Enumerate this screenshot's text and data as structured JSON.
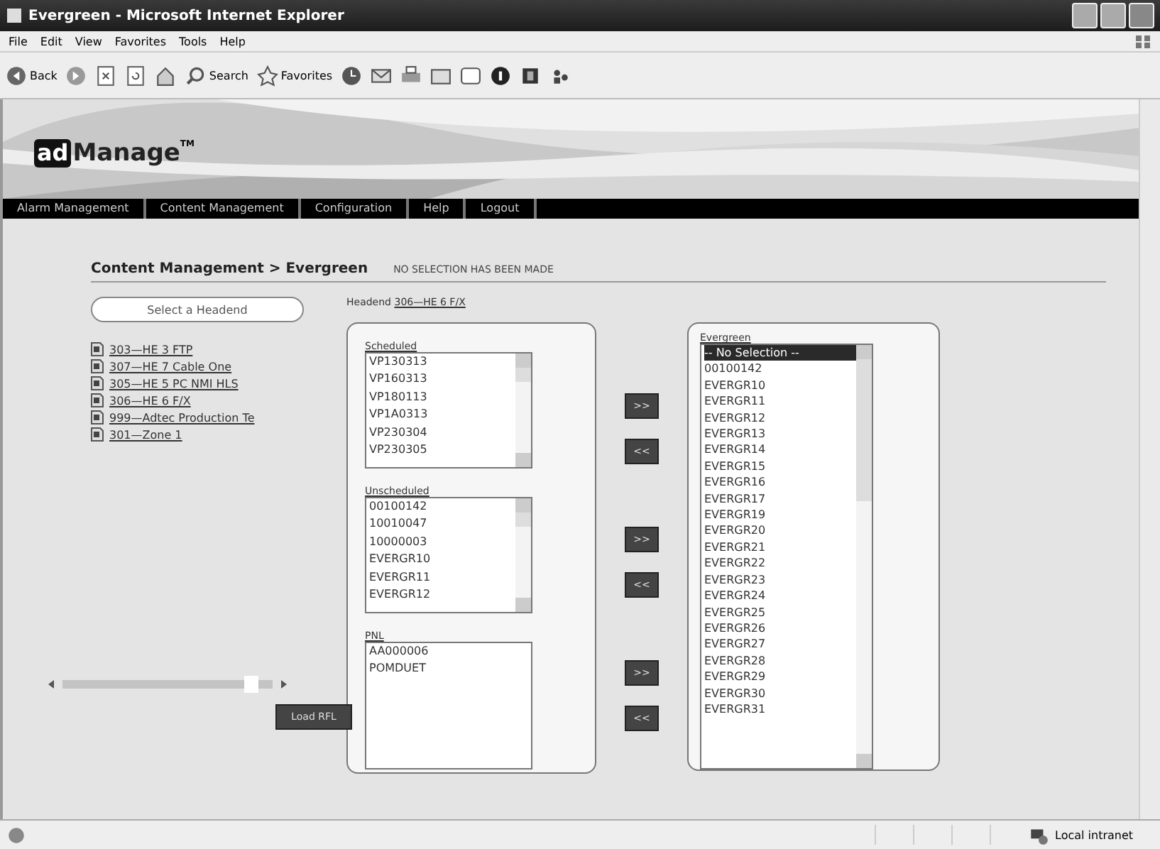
{
  "window": {
    "title": "Evergreen - Microsoft Internet Explorer"
  },
  "menu": [
    "File",
    "Edit",
    "View",
    "Favorites",
    "Tools",
    "Help"
  ],
  "toolbar": {
    "back": "Back",
    "search": "Search",
    "favorites": "Favorites"
  },
  "logo": {
    "mark": "ad",
    "name": "Manage",
    "tm": "TM"
  },
  "nav": [
    "Alarm Management",
    "Content Management",
    "Configuration",
    "Help",
    "Logout"
  ],
  "breadcrumb": "Content Management > Evergreen",
  "notice": "NO SELECTION HAS BEEN MADE",
  "headend_button": "Select a Headend",
  "headends": [
    "303—HE 3 FTP",
    "307—HE 7 Cable One",
    "305—HE 5 PC NMI HLS",
    "306—HE 6 F/X",
    "999—Adtec Production Te",
    "301—Zone 1"
  ],
  "headend": {
    "label": "Headend",
    "value": "306—HE 6 F/X"
  },
  "lists": [
    {
      "label": "Scheduled",
      "scrollbar": true,
      "items": [
        "VP130313",
        "VP160313",
        "VP180113",
        "VP1A0313",
        "VP230304",
        "VP230305"
      ],
      "buttons": [
        ">>",
        "<<"
      ]
    },
    {
      "label": "Unscheduled",
      "scrollbar": true,
      "items": [
        "00100142",
        "10010047",
        "10000003",
        "EVERGR10",
        "EVERGR11",
        "EVERGR12"
      ],
      "buttons": [
        ">>",
        "<<"
      ]
    },
    {
      "label": "PNL",
      "scrollbar": false,
      "items": [
        "AA000006",
        "POMDUET"
      ],
      "buttons": [
        ">>",
        "<<"
      ]
    }
  ],
  "evergreen": {
    "label": "Evergreen",
    "items": [
      {
        "text": "-- No Selection --",
        "selected": true
      },
      {
        "text": "00100142",
        "selected": false
      },
      {
        "text": "EVERGR10",
        "selected": false
      },
      {
        "text": "EVERGR11",
        "selected": false
      },
      {
        "text": "EVERGR12",
        "selected": false
      },
      {
        "text": "EVERGR13",
        "selected": false
      },
      {
        "text": "EVERGR14",
        "selected": false
      },
      {
        "text": "EVERGR15",
        "selected": false
      },
      {
        "text": "EVERGR16",
        "selected": false
      },
      {
        "text": "EVERGR17",
        "selected": false
      },
      {
        "text": "EVERGR19",
        "selected": false
      },
      {
        "text": "EVERGR20",
        "selected": false
      },
      {
        "text": "EVERGR21",
        "selected": false
      },
      {
        "text": "EVERGR22",
        "selected": false
      },
      {
        "text": "EVERGR23",
        "selected": false
      },
      {
        "text": "EVERGR24",
        "selected": false
      },
      {
        "text": "EVERGR25",
        "selected": false
      },
      {
        "text": "EVERGR26",
        "selected": false
      },
      {
        "text": "EVERGR27",
        "selected": false
      },
      {
        "text": "EVERGR28",
        "selected": false
      },
      {
        "text": "EVERGR29",
        "selected": false
      },
      {
        "text": "EVERGR30",
        "selected": false
      },
      {
        "text": "EVERGR31",
        "selected": false
      }
    ]
  },
  "slider": {
    "level": 0.93
  },
  "load_button": "Load RFL",
  "status": {
    "zone": "Local intranet"
  }
}
